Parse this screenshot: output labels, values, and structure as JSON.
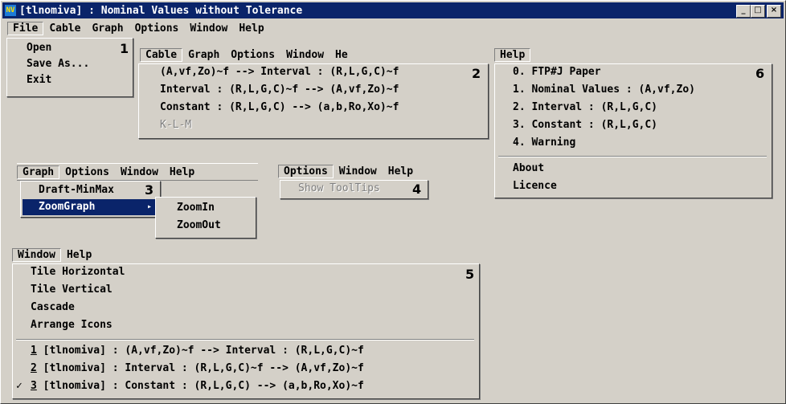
{
  "window": {
    "title": "[tlnomiva] : Nominal Values without Tolerance",
    "minimize": "_",
    "maximize": "□",
    "close": "×"
  },
  "menubar": [
    "File",
    "Cable",
    "Graph",
    "Options",
    "Window",
    "Help"
  ],
  "file_menu": {
    "items": [
      "Open",
      "Save As...",
      "Exit"
    ],
    "number": "1"
  },
  "cable_panel": {
    "bar": [
      "Cable",
      "Graph",
      "Options",
      "Window",
      "He"
    ],
    "items": [
      "(A,vf,Zo)~f --> Interval : (R,L,G,C)~f",
      "Interval : (R,L,G,C)~f --> (A,vf,Zo)~f",
      "Constant : (R,L,G,C) --> (a,b,Ro,Xo)~f",
      "K-L-M"
    ],
    "number": "2"
  },
  "graph_panel": {
    "bar": [
      "Graph",
      "Options",
      "Window",
      "Help"
    ],
    "items": [
      "Draft-MinMax",
      "ZoomGraph"
    ],
    "submenu": [
      "ZoomIn",
      "ZoomOut"
    ],
    "number": "3"
  },
  "options_panel": {
    "bar": [
      "Options",
      "Window",
      "Help"
    ],
    "items": [
      "Show ToolTips"
    ],
    "number": "4"
  },
  "window_panel": {
    "bar": [
      "Window",
      "Help"
    ],
    "items": [
      "Tile Horizontal",
      "Tile Vertical",
      "Cascade",
      "Arrange Icons"
    ],
    "docs": [
      {
        "n": "1",
        "text": "[tlnomiva] : (A,vf,Zo)~f --> Interval : (R,L,G,C)~f"
      },
      {
        "n": "2",
        "text": "[tlnomiva] : Interval : (R,L,G,C)~f --> (A,vf,Zo)~f"
      },
      {
        "n": "3",
        "text": "[tlnomiva] : Constant : (R,L,G,C) --> (a,b,Ro,Xo)~f"
      }
    ],
    "check": "✓",
    "number": "5"
  },
  "help_panel": {
    "bar": [
      "Help"
    ],
    "items": [
      "0. FTP#J Paper",
      "1. Nominal Values : (A,vf,Zo)",
      "2. Interval : (R,L,G,C)",
      "3. Constant : (R,L,G,C)",
      "4. Warning"
    ],
    "items2": [
      "About",
      "Licence"
    ],
    "number": "6"
  }
}
